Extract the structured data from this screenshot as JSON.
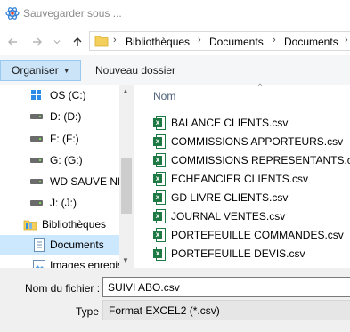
{
  "window": {
    "title": "Sauvegarder sous ..."
  },
  "address_bar": {
    "breadcrumbs": [
      "Bibliothèques",
      "Documents",
      "Documents"
    ]
  },
  "toolbar": {
    "organize_label": "Organiser",
    "new_folder_label": "Nouveau dossier"
  },
  "sidebar": {
    "items": [
      {
        "label": "OS (C:)",
        "icon": "windows-drive-icon"
      },
      {
        "label": "D: (D:)",
        "icon": "drive-icon"
      },
      {
        "label": "F: (F:)",
        "icon": "drive-icon"
      },
      {
        "label": "G: (G:)",
        "icon": "drive-icon"
      },
      {
        "label": "WD SAUVE NID",
        "icon": "drive-icon"
      },
      {
        "label": "J: (J:)",
        "icon": "drive-icon"
      },
      {
        "label": "Bibliothèques",
        "icon": "libraries-icon"
      },
      {
        "label": "Documents",
        "icon": "documents-icon",
        "selected": true
      },
      {
        "label": "Images enregis",
        "icon": "pictures-icon"
      }
    ]
  },
  "file_list": {
    "column_header": "Nom",
    "files": [
      "BALANCE CLIENTS.csv",
      "COMMISSIONS APPORTEURS.csv",
      "COMMISSIONS REPRESENTANTS.csv",
      "ECHEANCIER CLIENTS.csv",
      "GD LIVRE CLIENTS.csv",
      "JOURNAL VENTES.csv",
      "PORTEFEUILLE COMMANDES.csv",
      "PORTEFEUILLE DEVIS.csv"
    ]
  },
  "save_form": {
    "filename_label": "Nom du fichier :",
    "filename_value": "SUIVI ABO.csv",
    "type_label": "Type :",
    "type_value": "Format EXCEL2 (*.csv)"
  },
  "colors": {
    "accent_selected": "#cce8ff",
    "organize_button_bg": "#cce4f7",
    "excel_green": "#1d7a45"
  }
}
